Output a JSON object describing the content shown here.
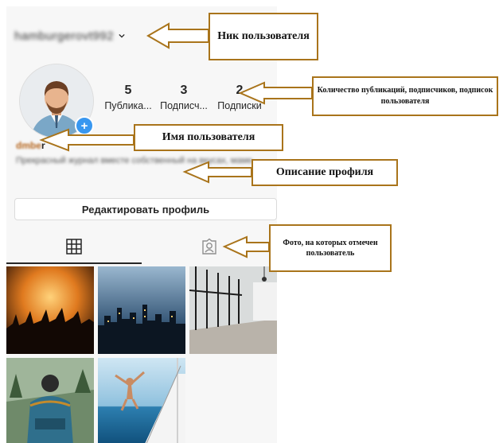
{
  "profile": {
    "username": "hamburgerovt992",
    "display_name_suffix": "r",
    "display_name_blurred": "dmbe",
    "bio_blurred": "Прекрасный журнал вместе собственный на вкусах, маме.",
    "stats": [
      {
        "value": "5",
        "label": "Публика..."
      },
      {
        "value": "3",
        "label": "Подписч..."
      },
      {
        "value": "2",
        "label": "Подписки"
      }
    ],
    "edit_button_label": "Редактировать профиль"
  },
  "icons": {
    "username_dropdown": "chevron-down-icon",
    "grid_tab": "grid-icon",
    "tagged_tab": "tagged-person-icon",
    "avatar_badge": "plus-icon"
  },
  "photos": [
    {
      "name": "concert-crowd-photo"
    },
    {
      "name": "city-skyline-night-photo"
    },
    {
      "name": "office-interior-photo"
    },
    {
      "name": "backpacker-forest-photo"
    },
    {
      "name": "sailboat-sea-photo"
    }
  ],
  "annotations": {
    "nickname": "Ник пользователя",
    "stats": "Количество публикаций, подписчиков, подписок пользователя",
    "name": "Имя пользователя",
    "description": "Описание профиля",
    "tagged": "Фото, на которых отмечен пользователь"
  },
  "colors": {
    "callout_border": "#a9741b",
    "badge": "#3897f0",
    "panel_bg": "#f7f7f7"
  }
}
